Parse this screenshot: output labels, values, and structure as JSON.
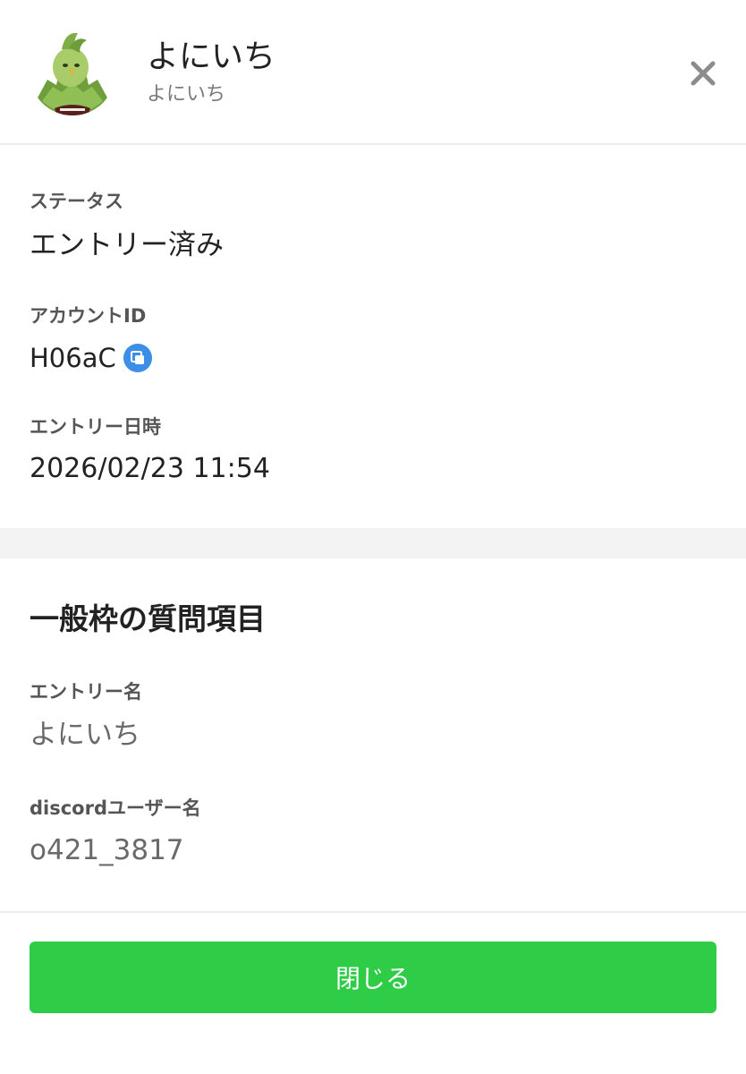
{
  "header": {
    "display_name": "よにいち",
    "sub_name": "よにいち",
    "avatar": "avatar-image",
    "close_icon": "close-icon"
  },
  "entry_info": {
    "status_label": "ステータス",
    "status_value": "エントリー済み",
    "account_id_label": "アカウントID",
    "account_id_value": "H06aC",
    "copy_icon": "copy-icon",
    "entry_datetime_label": "エントリー日時",
    "entry_datetime_value": "2026/02/23 11:54"
  },
  "questions": {
    "section_title": "一般枠の質問項目",
    "items": [
      {
        "label": "エントリー名",
        "value": "よにいち"
      },
      {
        "label": "discordユーザー名",
        "value": "o421_3817"
      }
    ]
  },
  "footer": {
    "close_button_label": "閉じる"
  },
  "colors": {
    "primary_button": "#2ecc47",
    "copy_icon_bg": "#3d8ee6",
    "close_icon": "#8c8c8c"
  }
}
